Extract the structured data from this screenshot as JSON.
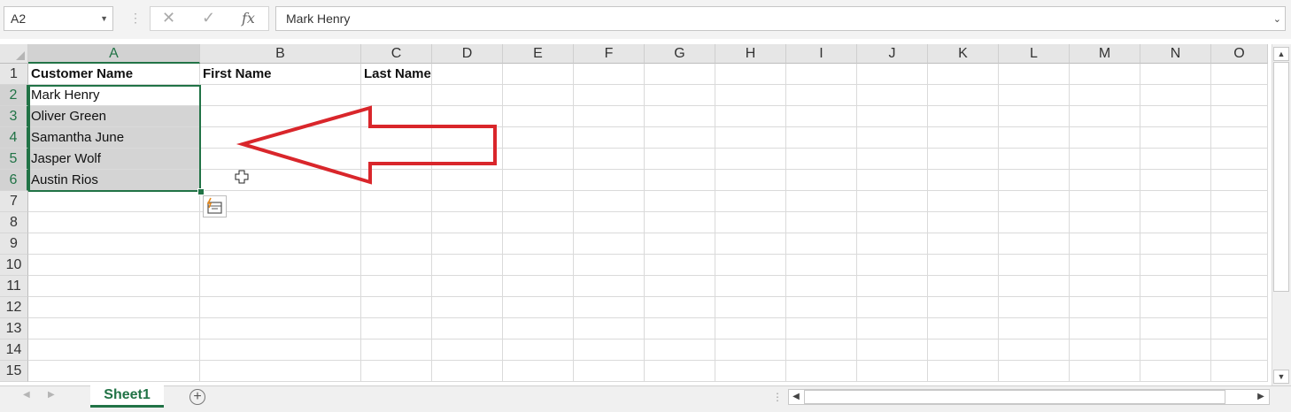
{
  "formula_bar": {
    "name_box": "A2",
    "formula": "Mark Henry",
    "fx_label": "fx",
    "cancel_glyph": "✕",
    "enter_glyph": "✓"
  },
  "columns": [
    "A",
    "B",
    "C",
    "D",
    "E",
    "F",
    "G",
    "H",
    "I",
    "J",
    "K",
    "L",
    "M",
    "N",
    "O"
  ],
  "rows": [
    "1",
    "2",
    "3",
    "4",
    "5",
    "6",
    "7",
    "8",
    "9",
    "10",
    "11",
    "12",
    "13",
    "14",
    "15"
  ],
  "cells": {
    "A1": "Customer Name",
    "B1": "First Name",
    "C1": "Last Name",
    "A2": "Mark Henry",
    "A3": "Oliver Green",
    "A4": "Samantha June",
    "A5": "Jasper Wolf",
    "A6": "Austin Rios"
  },
  "selection": {
    "active_cell": "A2",
    "range": "A2:A6"
  },
  "annotation": {
    "color": "#d9262b",
    "shape": "arrow-left"
  },
  "sheet_tabs": [
    {
      "label": "Sheet1",
      "active": true
    }
  ],
  "accent_color": "#217346",
  "icons": [
    "chevron-down-icon",
    "cancel-icon",
    "check-icon",
    "fx-icon",
    "quick-analysis-icon",
    "add-sheet-icon",
    "scroll-up-icon",
    "scroll-down-icon",
    "scroll-left-icon",
    "scroll-right-icon"
  ]
}
